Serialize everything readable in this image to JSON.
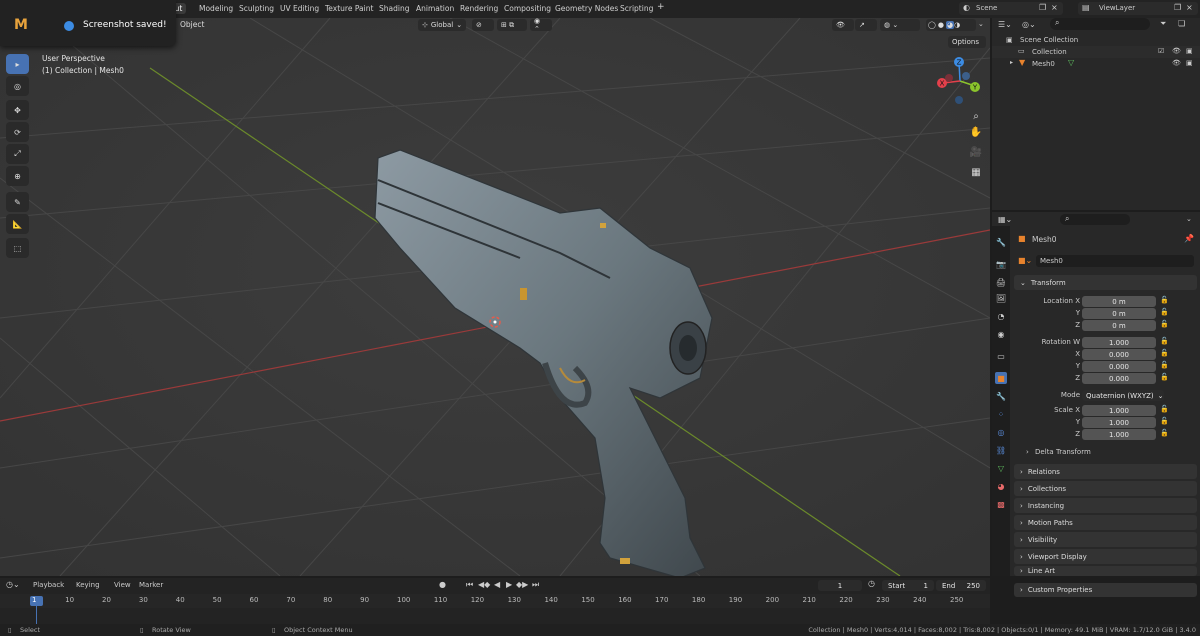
{
  "topbar": {
    "workspaces": [
      "Layout",
      "Modeling",
      "Sculpting",
      "UV Editing",
      "Texture Paint",
      "Shading",
      "Animation",
      "Rendering",
      "Compositing",
      "Geometry Nodes",
      "Scripting"
    ],
    "active_workspace": "Layout",
    "active_visible_label": "out",
    "add_label": "+",
    "scene_name": "Scene",
    "view_layer": "ViewLayer"
  },
  "toast": {
    "message": "Screenshot saved!",
    "logo": "M"
  },
  "viewport": {
    "object_menu": "Object",
    "transform_orientation": "Global",
    "options_label": "Options",
    "info_line1": "User Perspective",
    "info_line2": "(1) Collection | Mesh0",
    "axis_labels": {
      "x": "X",
      "y": "Y",
      "z": "Z"
    }
  },
  "outliner": {
    "root": "Scene Collection",
    "collection": "Collection",
    "object": "Mesh0"
  },
  "properties": {
    "object_name": "Mesh0",
    "data_name": "Mesh0",
    "transform_header": "Transform",
    "location": {
      "label": "Location X",
      "x": "0 m",
      "y": "0 m",
      "z": "0 m"
    },
    "rotation": {
      "label": "Rotation W",
      "w": "1.000",
      "x": "0.000",
      "y": "0.000",
      "z": "0.000"
    },
    "mode_label": "Mode",
    "mode_value": "Quaternion (WXYZ)",
    "scale": {
      "label": "Scale X",
      "x": "1.000",
      "y": "1.000",
      "z": "1.000"
    },
    "axis_y": "Y",
    "axis_z": "Z",
    "axis_x": "X",
    "delta_transform": "Delta Transform",
    "panels": [
      "Relations",
      "Collections",
      "Instancing",
      "Motion Paths",
      "Visibility",
      "Viewport Display",
      "Line Art",
      "Custom Properties"
    ]
  },
  "timeline": {
    "menu": [
      "Playback",
      "Keying",
      "View",
      "Marker"
    ],
    "current_frame": "1",
    "start_label": "Start",
    "start": "1",
    "end_label": "End",
    "end": "250",
    "ticks": [
      "1",
      "10",
      "20",
      "30",
      "40",
      "50",
      "60",
      "70",
      "80",
      "90",
      "100",
      "110",
      "120",
      "130",
      "140",
      "150",
      "160",
      "170",
      "180",
      "190",
      "200",
      "210",
      "220",
      "230",
      "240",
      "250"
    ]
  },
  "status": {
    "select": "Select",
    "rotate": "Rotate View",
    "context": "Object Context Menu",
    "stats": "Collection | Mesh0 | Verts:4,014 | Faces:8,002 | Tris:8,002 | Objects:0/1 | Memory: 49.1 MiB | VRAM: 1.7/12.0 GiB | 3.4.0"
  },
  "colors": {
    "accent": "#4772b3",
    "object_orange": "#e8832d",
    "x_axis": "#e4404b",
    "y_axis": "#8bc42c",
    "z_axis": "#3c8ce4"
  }
}
